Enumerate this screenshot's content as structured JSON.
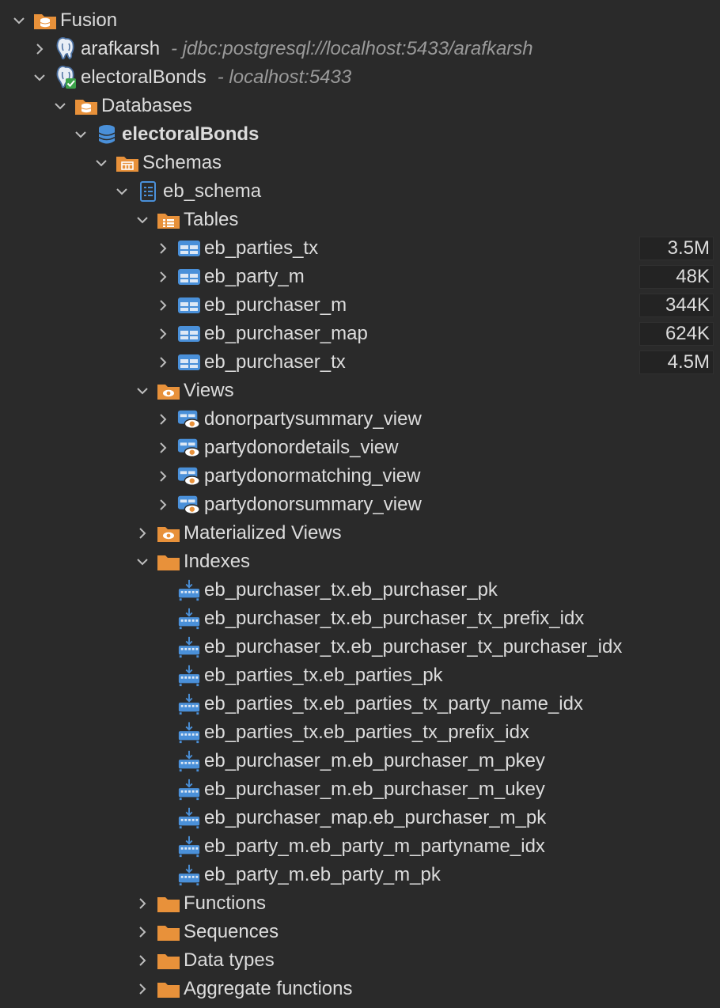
{
  "tree": [
    {
      "id": "fusion",
      "label": "Fusion",
      "level": 0,
      "expanded": true,
      "icon": "db-folder-icon"
    },
    {
      "id": "arafkarsh",
      "label": "arafkarsh",
      "desc": "- jdbc:postgresql://localhost:5433/arafkarsh",
      "level": 1,
      "expanded": false,
      "icon": "postgres-icon"
    },
    {
      "id": "electoralbonds-conn",
      "label": "electoralBonds",
      "desc": "- localhost:5433",
      "level": 1,
      "expanded": true,
      "icon": "postgres-connected-icon"
    },
    {
      "id": "databases",
      "label": "Databases",
      "level": 2,
      "expanded": true,
      "icon": "db-folder-icon"
    },
    {
      "id": "electoralbonds-db",
      "label": "electoralBonds",
      "level": 3,
      "expanded": true,
      "icon": "database-icon",
      "bold": true
    },
    {
      "id": "schemas",
      "label": "Schemas",
      "level": 4,
      "expanded": true,
      "icon": "schemas-folder-icon"
    },
    {
      "id": "eb-schema",
      "label": "eb_schema",
      "level": 5,
      "expanded": true,
      "icon": "schema-icon"
    },
    {
      "id": "tables",
      "label": "Tables",
      "level": 6,
      "expanded": true,
      "icon": "tables-folder-icon"
    },
    {
      "id": "eb-parties-tx",
      "label": "eb_parties_tx",
      "level": 7,
      "expanded": false,
      "icon": "table-icon",
      "size": "3.5M"
    },
    {
      "id": "eb-party-m",
      "label": "eb_party_m",
      "level": 7,
      "expanded": false,
      "icon": "table-icon",
      "size": "48K"
    },
    {
      "id": "eb-purchaser-m",
      "label": "eb_purchaser_m",
      "level": 7,
      "expanded": false,
      "icon": "table-icon",
      "size": "344K"
    },
    {
      "id": "eb-purchaser-map",
      "label": "eb_purchaser_map",
      "level": 7,
      "expanded": false,
      "icon": "table-icon",
      "size": "624K"
    },
    {
      "id": "eb-purchaser-tx",
      "label": "eb_purchaser_tx",
      "level": 7,
      "expanded": false,
      "icon": "table-icon",
      "size": "4.5M"
    },
    {
      "id": "views",
      "label": "Views",
      "level": 6,
      "expanded": true,
      "icon": "views-folder-icon"
    },
    {
      "id": "donorpartysummary-view",
      "label": "donorpartysummary_view",
      "level": 7,
      "expanded": false,
      "icon": "view-icon"
    },
    {
      "id": "partydonordetails-view",
      "label": "partydonordetails_view",
      "level": 7,
      "expanded": false,
      "icon": "view-icon"
    },
    {
      "id": "partydonormatching-view",
      "label": "partydonormatching_view",
      "level": 7,
      "expanded": false,
      "icon": "view-icon"
    },
    {
      "id": "partydonorsummary-view",
      "label": "partydonorsummary_view",
      "level": 7,
      "expanded": false,
      "icon": "view-icon"
    },
    {
      "id": "materialized-views",
      "label": "Materialized Views",
      "level": 6,
      "expanded": false,
      "icon": "views-folder-icon"
    },
    {
      "id": "indexes",
      "label": "Indexes",
      "level": 6,
      "expanded": true,
      "icon": "folder-icon"
    },
    {
      "id": "idx-1",
      "label": "eb_purchaser_tx.eb_purchaser_pk",
      "level": 7,
      "leaf": true,
      "icon": "index-icon"
    },
    {
      "id": "idx-2",
      "label": "eb_purchaser_tx.eb_purchaser_tx_prefix_idx",
      "level": 7,
      "leaf": true,
      "icon": "index-icon"
    },
    {
      "id": "idx-3",
      "label": "eb_purchaser_tx.eb_purchaser_tx_purchaser_idx",
      "level": 7,
      "leaf": true,
      "icon": "index-icon"
    },
    {
      "id": "idx-4",
      "label": "eb_parties_tx.eb_parties_pk",
      "level": 7,
      "leaf": true,
      "icon": "index-icon"
    },
    {
      "id": "idx-5",
      "label": "eb_parties_tx.eb_parties_tx_party_name_idx",
      "level": 7,
      "leaf": true,
      "icon": "index-icon"
    },
    {
      "id": "idx-6",
      "label": "eb_parties_tx.eb_parties_tx_prefix_idx",
      "level": 7,
      "leaf": true,
      "icon": "index-icon"
    },
    {
      "id": "idx-7",
      "label": "eb_purchaser_m.eb_purchaser_m_pkey",
      "level": 7,
      "leaf": true,
      "icon": "index-icon"
    },
    {
      "id": "idx-8",
      "label": "eb_purchaser_m.eb_purchaser_m_ukey",
      "level": 7,
      "leaf": true,
      "icon": "index-icon"
    },
    {
      "id": "idx-9",
      "label": "eb_purchaser_map.eb_purchaser_m_pk",
      "level": 7,
      "leaf": true,
      "icon": "index-icon"
    },
    {
      "id": "idx-10",
      "label": "eb_party_m.eb_party_m_partyname_idx",
      "level": 7,
      "leaf": true,
      "icon": "index-icon"
    },
    {
      "id": "idx-11",
      "label": "eb_party_m.eb_party_m_pk",
      "level": 7,
      "leaf": true,
      "icon": "index-icon"
    },
    {
      "id": "functions",
      "label": "Functions",
      "level": 6,
      "expanded": false,
      "icon": "folder-icon"
    },
    {
      "id": "sequences",
      "label": "Sequences",
      "level": 6,
      "expanded": false,
      "icon": "folder-icon"
    },
    {
      "id": "data-types",
      "label": "Data types",
      "level": 6,
      "expanded": false,
      "icon": "folder-icon"
    },
    {
      "id": "aggregate-functions",
      "label": "Aggregate functions",
      "level": 6,
      "expanded": false,
      "icon": "folder-icon"
    }
  ],
  "colors": {
    "background": "#2a2a2a",
    "text": "#dcdcdc",
    "desc": "#9a9a9a",
    "orange": "#e8913a",
    "blue": "#4a90d9",
    "chevron": "#bdbdbd"
  }
}
